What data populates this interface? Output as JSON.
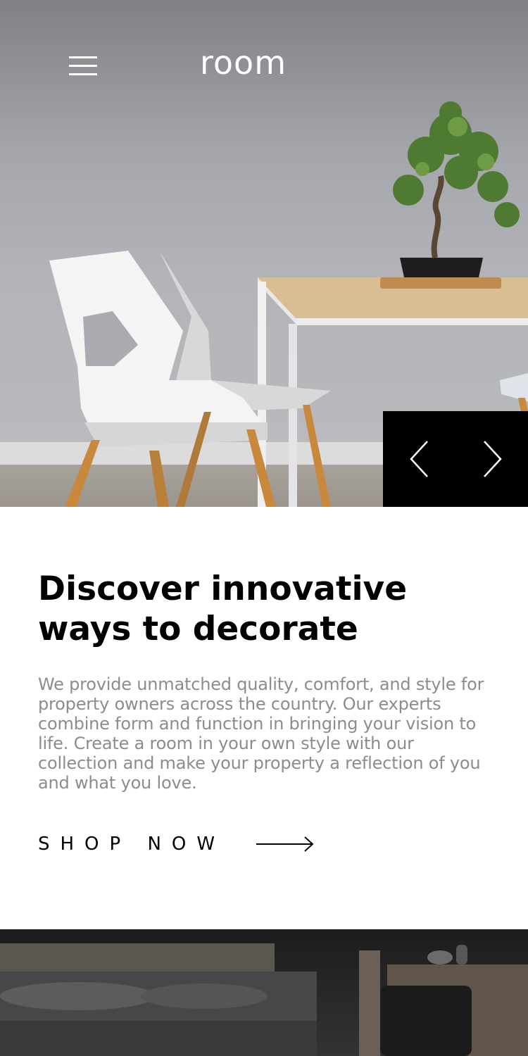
{
  "header": {
    "logo": "room",
    "menu_icon": "hamburger-menu-icon"
  },
  "hero": {
    "image_description": "white chairs beside wooden table with bonsai plant",
    "controls": {
      "prev_icon": "chevron-left-icon",
      "next_icon": "chevron-right-icon"
    }
  },
  "main": {
    "headline_line1": "Discover innovative",
    "headline_line2": "ways to decorate",
    "description": "We provide unmatched quality, comfort, and style for property owners across the country. Our experts combine form and function in bringing your vision to life. Create a room in your own style with our collection and make your property a reflection of you and what you love.",
    "cta_label": "SHOP NOW",
    "cta_icon": "arrow-right-icon"
  },
  "colors": {
    "text_primary": "#000000",
    "text_secondary": "#8c8c8c",
    "control_bg": "#000000",
    "header_text": "#ffffff"
  }
}
